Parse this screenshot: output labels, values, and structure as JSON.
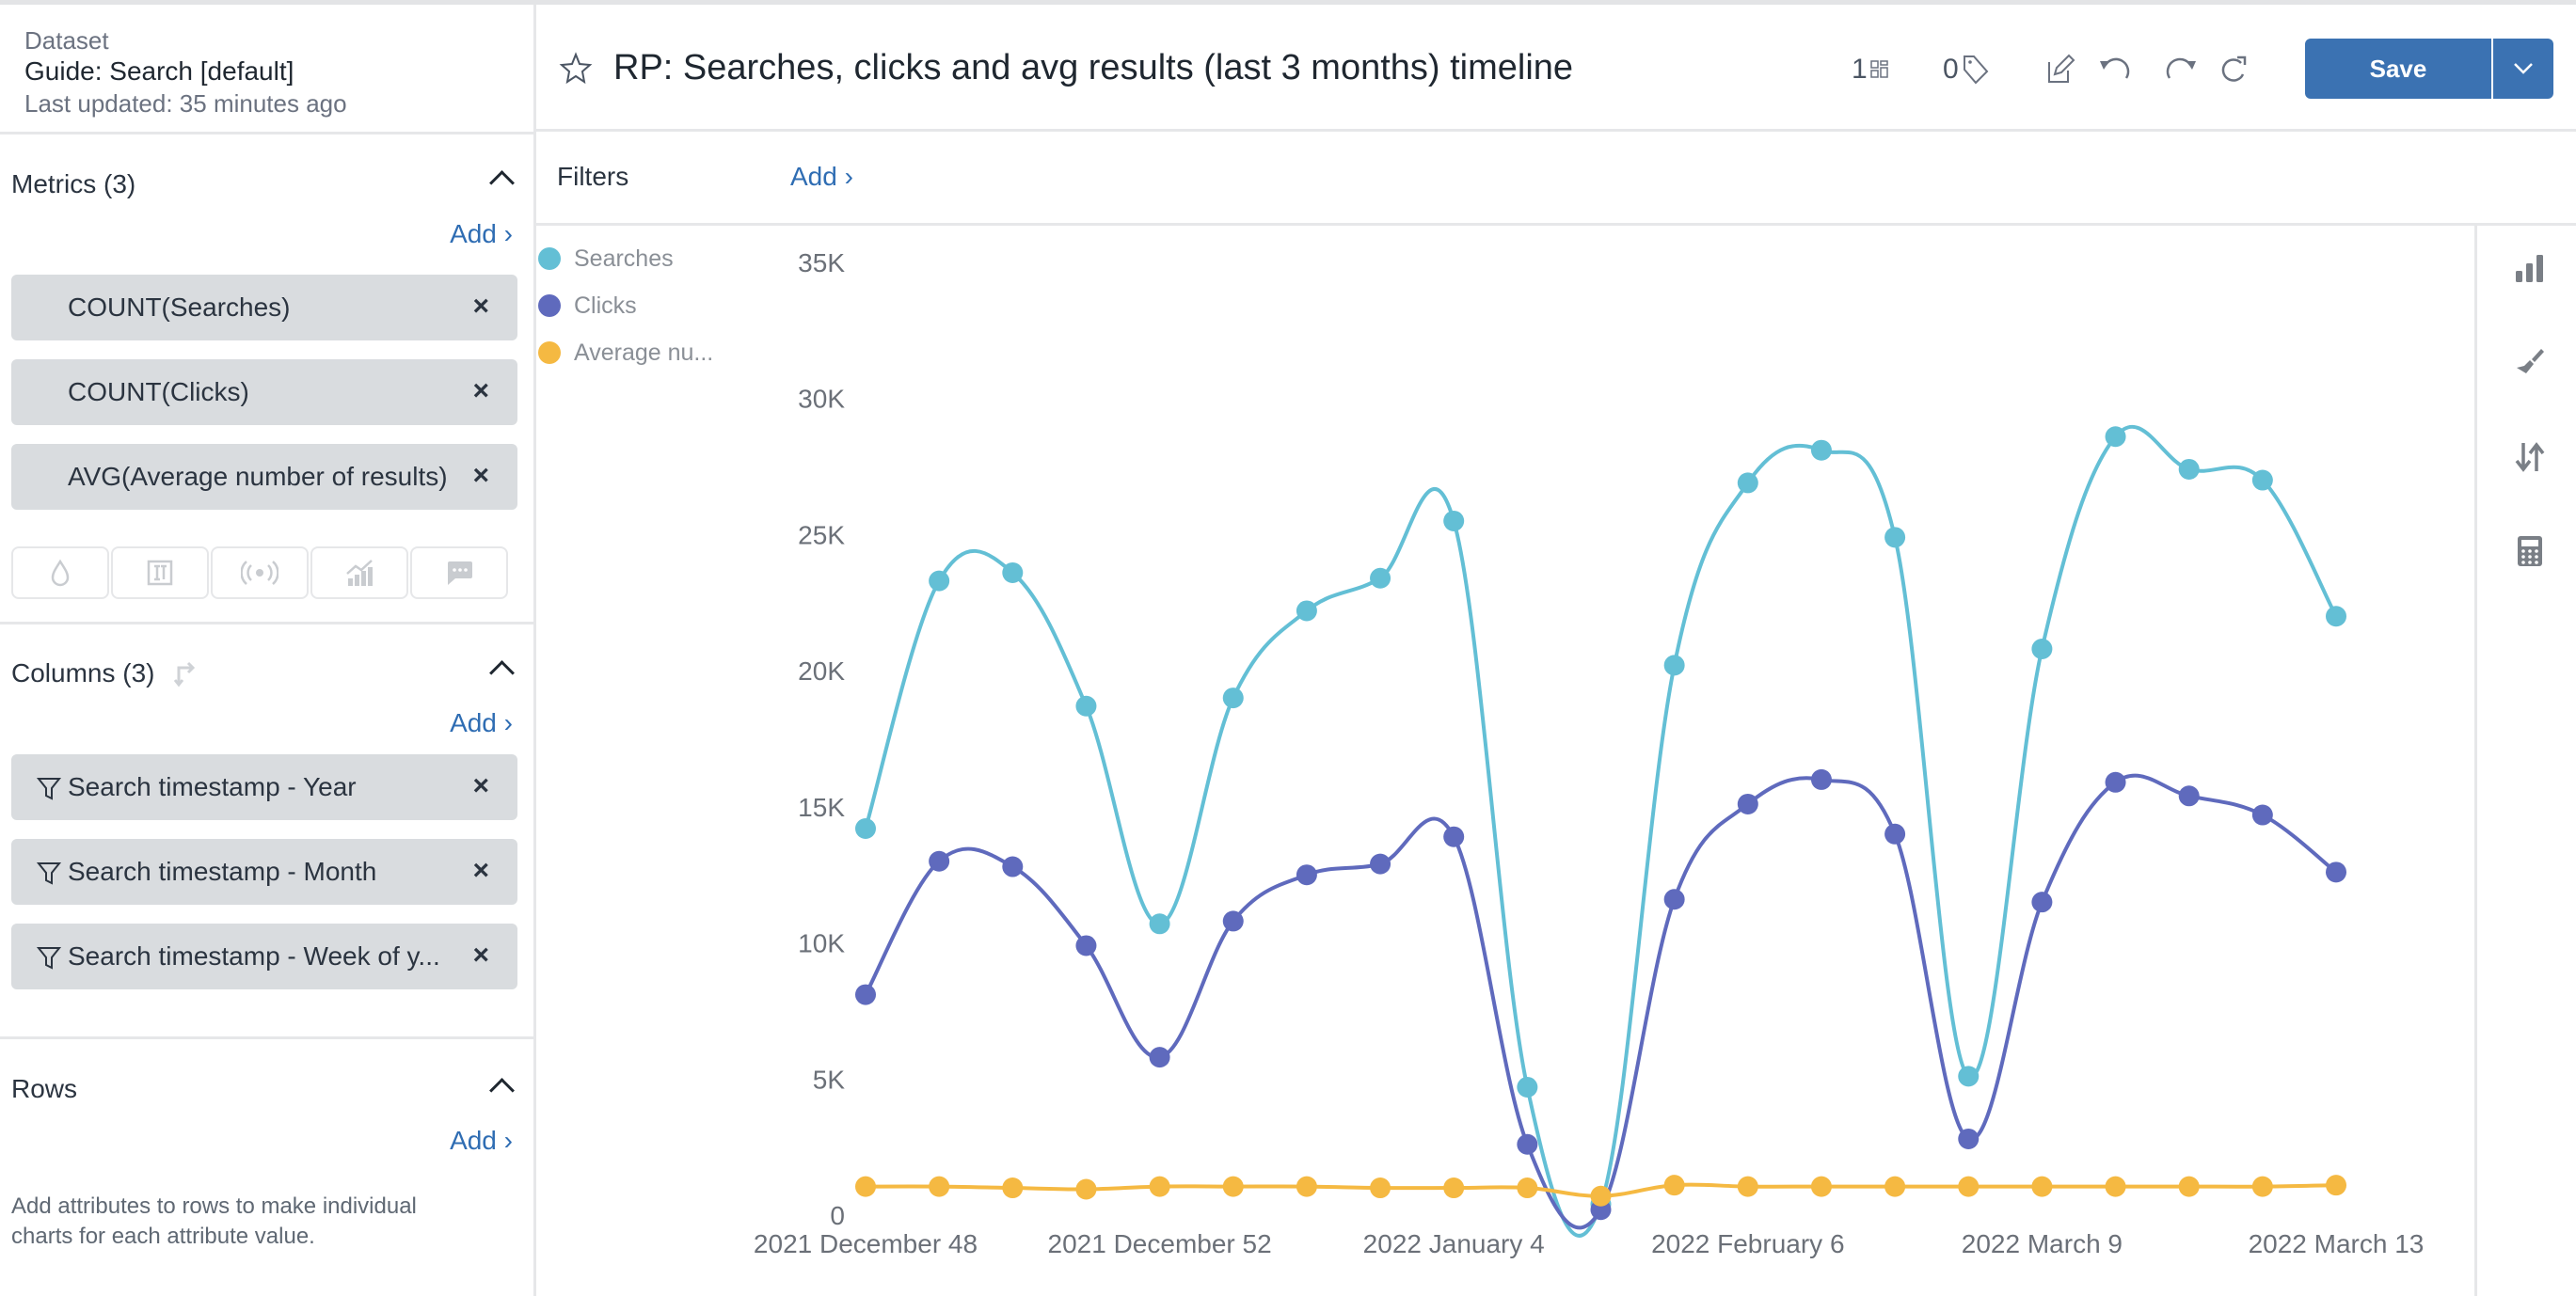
{
  "dataset": {
    "label": "Dataset",
    "name": "Guide: Search [default]",
    "updated": "Last updated: 35 minutes ago"
  },
  "header": {
    "title": "RP: Searches, clicks and avg results (last 3 months) timeline",
    "dashboards_count": "1",
    "tags_count": "0",
    "save_label": "Save"
  },
  "sidebar": {
    "metrics": {
      "title": "Metrics (3)",
      "add_label": "Add ›",
      "items": [
        "COUNT(Searches)",
        "COUNT(Clicks)",
        "AVG(Average number of results)"
      ],
      "icons": [
        "color-icon",
        "size-icon",
        "signal-icon",
        "trend-icon",
        "comment-icon"
      ]
    },
    "columns": {
      "title": "Columns (3)",
      "add_label": "Add ›",
      "items": [
        "Search timestamp - Year",
        "Search timestamp - Month",
        "Search timestamp - Week of y..."
      ]
    },
    "rows": {
      "title": "Rows",
      "add_label": "Add ›",
      "help": "Add attributes to rows to make individual charts for each attribute value."
    }
  },
  "filters": {
    "label": "Filters",
    "add_label": "Add ›"
  },
  "colors": {
    "searches": "#63bfd5",
    "clicks": "#5f6abd",
    "average": "#f5b942",
    "accent": "#3b72b2"
  },
  "chart_data": {
    "type": "line",
    "title": "RP: Searches, clicks and avg results (last 3 months) timeline",
    "xlabel": "",
    "ylabel": "",
    "ylim": [
      0,
      35000
    ],
    "yticks": [
      0,
      5000,
      10000,
      15000,
      20000,
      25000,
      30000,
      35000
    ],
    "ytick_labels": [
      "0",
      "5K",
      "10K",
      "15K",
      "20K",
      "25K",
      "30K",
      "35K"
    ],
    "grid": false,
    "legend": "left",
    "x_count": 21,
    "x_tick_labels": [
      {
        "index": 0,
        "label": "2021 December 48"
      },
      {
        "index": 4,
        "label": "2021 December 52"
      },
      {
        "index": 8,
        "label": "2022 January 4"
      },
      {
        "index": 12,
        "label": "2022 February 6"
      },
      {
        "index": 16,
        "label": "2022 March 9"
      },
      {
        "index": 20,
        "label": "2022 March 13"
      }
    ],
    "series": [
      {
        "name": "Searches",
        "color": "#63bfd5",
        "values": [
          14200,
          23300,
          23600,
          18700,
          10700,
          19000,
          22200,
          23400,
          25500,
          4700,
          400,
          20200,
          26900,
          28100,
          24900,
          5100,
          20800,
          28600,
          27400,
          27000,
          22000
        ]
      },
      {
        "name": "Clicks",
        "color": "#5f6abd",
        "values": [
          8100,
          13000,
          12800,
          9900,
          5800,
          10800,
          12500,
          12900,
          13900,
          2600,
          200,
          11600,
          15100,
          16000,
          14000,
          2800,
          11500,
          15900,
          15400,
          14700,
          12600
        ]
      },
      {
        "name": "Average nu...",
        "color": "#f5b942",
        "values": [
          1050,
          1050,
          1000,
          950,
          1050,
          1050,
          1050,
          1000,
          1000,
          1000,
          700,
          1100,
          1050,
          1050,
          1050,
          1050,
          1050,
          1050,
          1050,
          1050,
          1100
        ]
      }
    ]
  }
}
